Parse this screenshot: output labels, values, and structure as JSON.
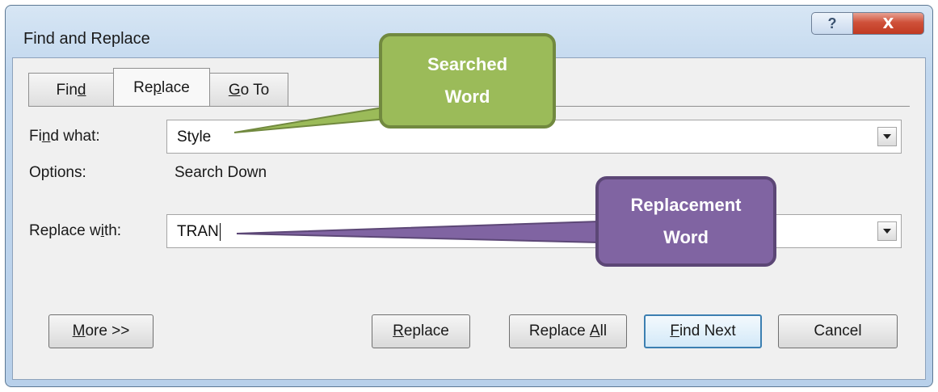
{
  "window": {
    "title": "Find and Replace"
  },
  "caption_buttons": {
    "help": "?",
    "close": "X"
  },
  "tabs": [
    {
      "label_pre": "Fin",
      "label_u": "d",
      "label_post": ""
    },
    {
      "label_pre": "Re",
      "label_u": "p",
      "label_post": "lace"
    },
    {
      "label_pre": "",
      "label_u": "G",
      "label_post": "o To"
    }
  ],
  "find": {
    "label_pre": "Fi",
    "label_u": "n",
    "label_post": "d what:",
    "value": "Style"
  },
  "options": {
    "label": "Options:",
    "value": "Search Down"
  },
  "replace": {
    "label_pre": "Replace w",
    "label_u": "i",
    "label_post": "th:",
    "value": "TRAN"
  },
  "buttons": {
    "more": {
      "pre": "",
      "u": "M",
      "post": "ore >>"
    },
    "replace": {
      "pre": "",
      "u": "R",
      "post": "eplace"
    },
    "replace_all": {
      "pre": "Replace ",
      "u": "A",
      "post": "ll"
    },
    "find_next": {
      "pre": "",
      "u": "F",
      "post": "ind Next"
    },
    "cancel": {
      "pre": "Cancel",
      "u": "",
      "post": ""
    }
  },
  "callouts": {
    "searched": {
      "line1": "Searched",
      "line2": "Word",
      "color": "#9bbb59"
    },
    "replacement": {
      "line1": "Replacement",
      "line2": "Word",
      "color": "#8064a2"
    }
  }
}
